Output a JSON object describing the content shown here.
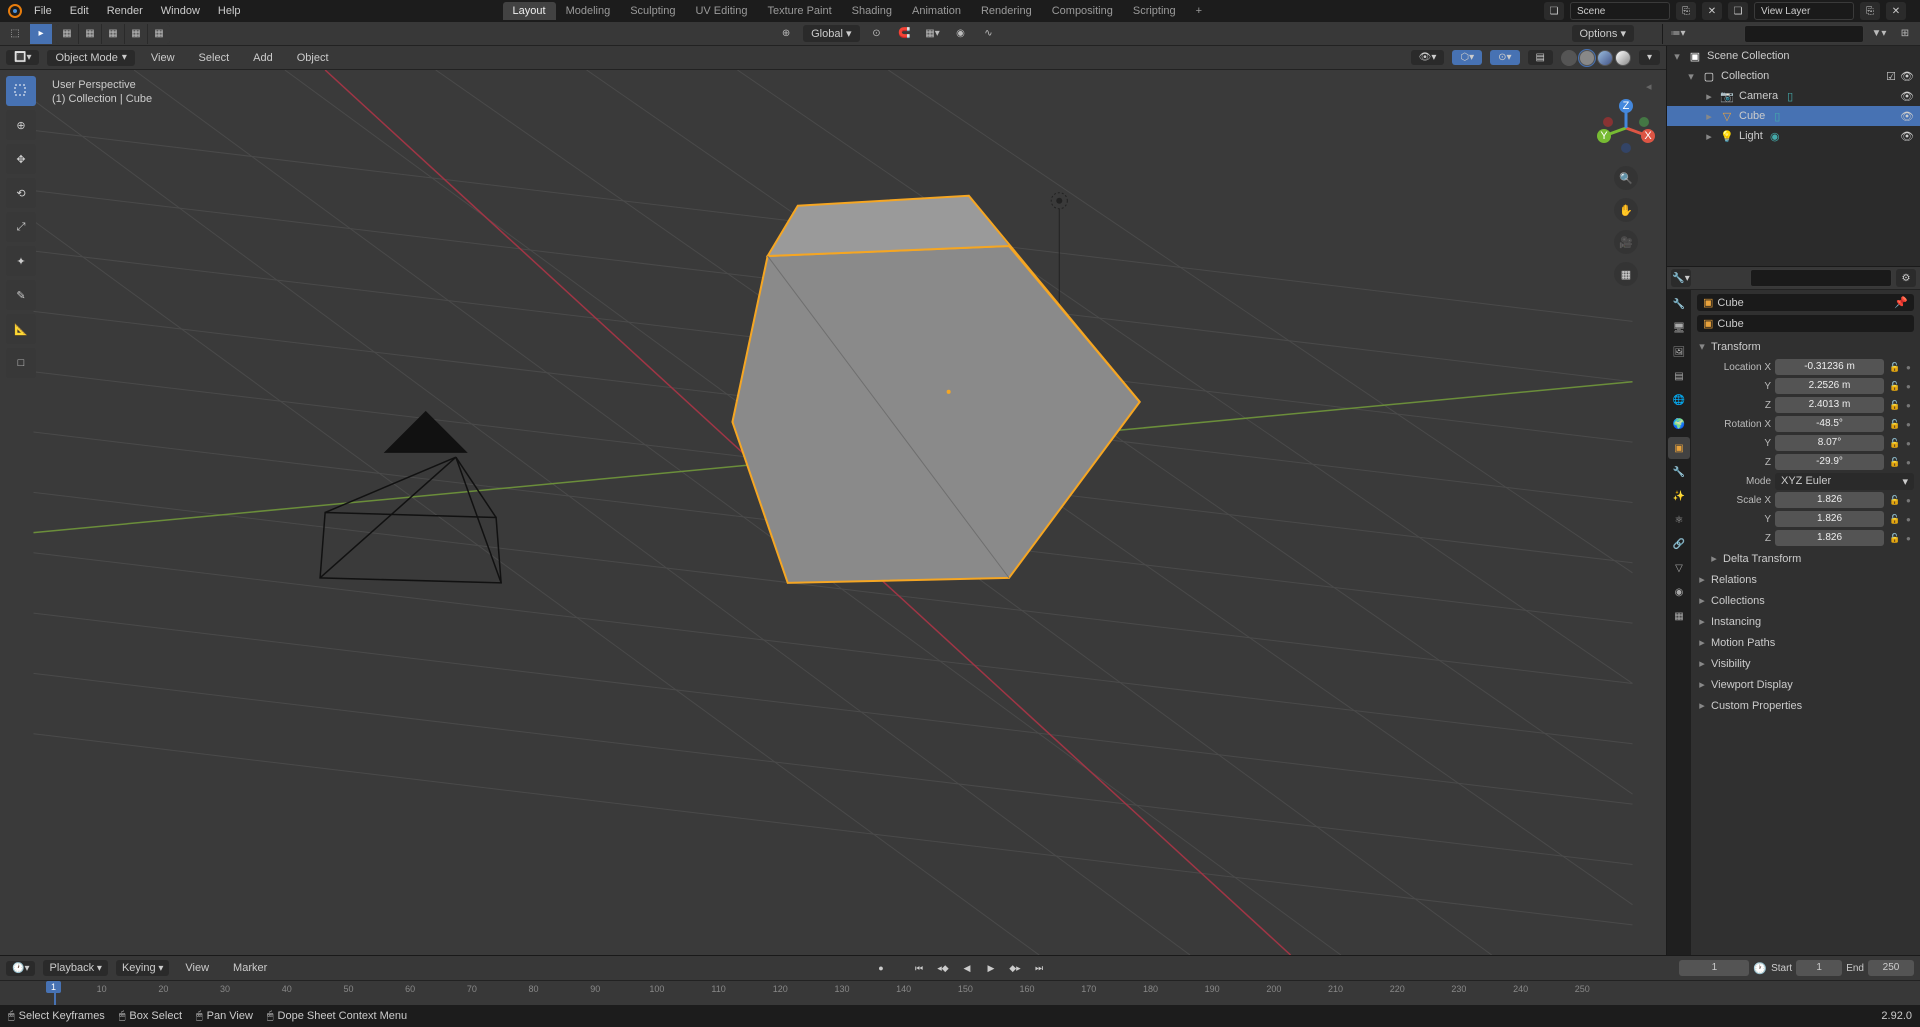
{
  "menus": [
    "File",
    "Edit",
    "Render",
    "Window",
    "Help"
  ],
  "workspaces": [
    "Layout",
    "Modeling",
    "Sculpting",
    "UV Editing",
    "Texture Paint",
    "Shading",
    "Animation",
    "Rendering",
    "Compositing",
    "Scripting"
  ],
  "active_workspace": "Layout",
  "scene_name": "Scene",
  "view_layer": "View Layer",
  "orientation": "Global",
  "options_label": "Options",
  "mode_label": "Object Mode",
  "header_menus": [
    "View",
    "Select",
    "Add",
    "Object"
  ],
  "overlay_title": "User Perspective",
  "overlay_sub": "(1) Collection | Cube",
  "outliner_root": "Scene Collection",
  "outliner": {
    "collection": "Collection",
    "items": [
      "Camera",
      "Cube",
      "Light"
    ]
  },
  "selected_item": "Cube",
  "object_name": "Cube",
  "panel_transform": "Transform",
  "transform": {
    "loc_x": "-0.31236 m",
    "loc_y": "2.2526 m",
    "loc_z": "2.4013 m",
    "rot_x": "-48.5°",
    "rot_y": "8.07°",
    "rot_z": "-29.9°",
    "scale_x": "1.826",
    "scale_y": "1.826",
    "scale_z": "1.826",
    "mode": "XYZ Euler"
  },
  "labels": {
    "loc": "Location X",
    "rot": "Rotation X",
    "scale": "Scale X",
    "mode": "Mode",
    "y": "Y",
    "z": "Z"
  },
  "panels_collapsed": [
    "Delta Transform",
    "Relations",
    "Collections",
    "Instancing",
    "Motion Paths",
    "Visibility",
    "Viewport Display",
    "Custom Properties"
  ],
  "timeline": {
    "menus": [
      "Playback",
      "Keying",
      "View",
      "Marker"
    ],
    "current": "1",
    "start_lbl": "Start",
    "start": "1",
    "end_lbl": "End",
    "end": "250",
    "ticks": [
      10,
      20,
      30,
      40,
      50,
      60,
      70,
      80,
      90,
      100,
      110,
      120,
      130,
      140,
      150,
      160,
      170,
      180,
      190,
      200,
      210,
      220,
      230,
      240,
      250
    ]
  },
  "status": {
    "a": "Select Keyframes",
    "b": "Box Select",
    "c": "Pan View",
    "d": "Dope Sheet Context Menu",
    "ver": "2.92.0"
  }
}
